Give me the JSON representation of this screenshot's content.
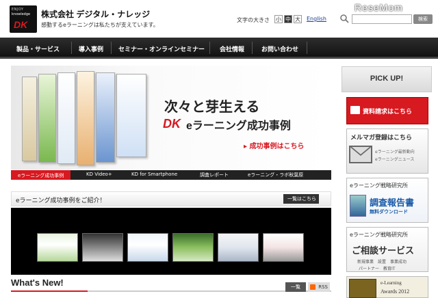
{
  "header": {
    "logo_tag": "ENJOY",
    "logo_knowledge": "knowledge",
    "logo_mark": "DK",
    "company": "株式会社 デジタル・ナレッジ",
    "tagline": "感動するeラーニングは私たちが支えています。",
    "font_size_label": "文字の大きさ",
    "font_small": "小",
    "font_mid": "中",
    "font_big": "大",
    "english": "English",
    "search_placeholder": "",
    "search_button": "検索",
    "watermark": "ReseMom"
  },
  "nav": {
    "items": [
      "製品・サービス",
      "導入事例",
      "セミナー・オンラインセミナー",
      "会社情報",
      "お問い合わせ"
    ]
  },
  "banner": {
    "headline": "次々と芽生える",
    "mark": "DK",
    "subhead": "eラーニング成功事例",
    "link": "▸ 成功事例はこちら",
    "tabs": [
      "eラーニング成功事例",
      "KD Video+",
      "KD for Smartphone",
      "調査レポート",
      "eラーニング・ラボ秋葉原"
    ]
  },
  "case_section": {
    "title": "eラーニング成功事例をご紹介！",
    "button": "一覧はこちら"
  },
  "whats_new": {
    "title": "What's New!",
    "list_button": "一覧",
    "rss_button": "RSS"
  },
  "sidebar": {
    "pickup": "PICK UP!",
    "request": "資料請求はこちら",
    "mail_title": "メルマガ登録はこちら",
    "mail_sub1": "eラーニング最新動向",
    "mail_sub2": "eラーニングニュース",
    "lab1_title": "eラーニング戦略研究所",
    "lab1_head": "調査報告書",
    "lab1_sub": "無料ダウンロード",
    "lab2_title": "eラーニング戦略研究所",
    "lab2_head": "ご相談サービス",
    "lab2_sub1": "新規事業　設置　事業成功",
    "lab2_sub2": "パートナー　教育IT",
    "award_t1": "e-Learning",
    "award_t2": "Awards 2012"
  },
  "colors": {
    "brand_red": "#d71920",
    "nav_dark": "#1a1a1a",
    "link_blue": "#1a3e8c"
  }
}
